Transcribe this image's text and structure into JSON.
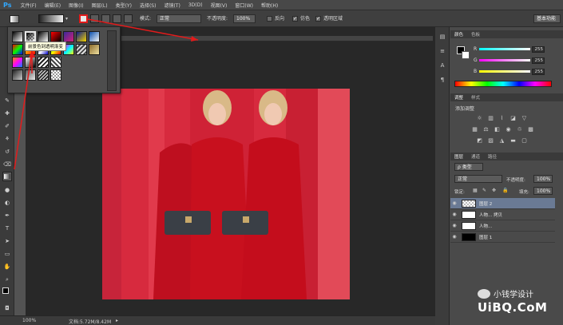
{
  "app": {
    "logo": "Ps"
  },
  "menu": [
    "文件(F)",
    "编辑(E)",
    "图像(I)",
    "图层(L)",
    "类型(Y)",
    "选择(S)",
    "滤镜(T)",
    "3D(D)",
    "视图(V)",
    "窗口(W)",
    "帮助(H)"
  ],
  "options": {
    "mode_label": "模式:",
    "mode_value": "正常",
    "opacity_label": "不透明度:",
    "opacity_value": "100%",
    "reverse_label": "反向",
    "dither_label": "仿色",
    "transparency_label": "透明区域",
    "workspace": "基本功能"
  },
  "picker": {
    "tooltip": "前景色到透明渐变"
  },
  "status": {
    "zoom": "100%",
    "doc": "文档:5.72M/8.42M"
  },
  "color_panel": {
    "tabs": [
      "颜色",
      "色板"
    ],
    "r_label": "R",
    "g_label": "G",
    "b_label": "B",
    "r": "255",
    "g": "255",
    "b": "255"
  },
  "adjust_panel": {
    "tabs": [
      "调整",
      "样式"
    ],
    "title": "添加调整"
  },
  "layers_panel": {
    "tabs": [
      "图层",
      "通道",
      "路径"
    ],
    "filter": "ρ 类型",
    "blend": "正常",
    "opacity_label": "不透明度:",
    "opacity": "100%",
    "lock_label": "锁定:",
    "fill_label": "填充:",
    "fill": "100%",
    "layers": [
      {
        "name": "图层 2",
        "selected": true
      },
      {
        "name": "人物... 拷贝",
        "selected": false
      },
      {
        "name": "人物...",
        "selected": false
      },
      {
        "name": "图层 1",
        "selected": false
      }
    ]
  },
  "watermark": {
    "line1": "小钱学设计",
    "line2": "UiBQ.CoM"
  },
  "colors": {
    "accent_red": "#e21b1b",
    "canvas_red": "#d72a3e",
    "selection_blue": "#6a7a94"
  }
}
